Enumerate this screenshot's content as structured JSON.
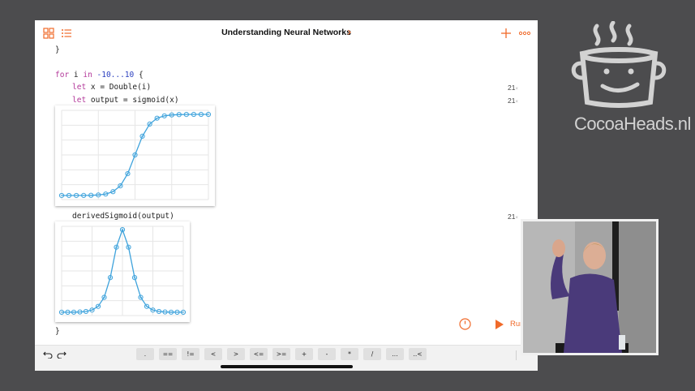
{
  "app": {
    "title": "Understanding Neural Networks",
    "accent_color": "#f06a2a",
    "top_left_icons": [
      "grid-icon",
      "list-icon"
    ],
    "top_right_icons": [
      "plus-icon",
      "more-icon"
    ]
  },
  "code": {
    "line_close_brace_1": "}",
    "line_for_kw1": "for",
    "line_for_var": " i ",
    "line_for_kw2": "in",
    "line_for_range": " -10...10",
    "line_for_open": " {",
    "line_let_x_kw": "let",
    "line_let_x_rest": " x = Double(i)",
    "line_let_output_kw": "let",
    "line_let_output_rest": " output = sigmoid(x)",
    "line_derived": "derivedSigmoid(output)",
    "line_close_brace_2": "}",
    "counts": [
      "21",
      "21",
      "21"
    ],
    "count_suffix": "×"
  },
  "run_button": {
    "label": "Run My Code"
  },
  "keyboard_keys": [
    ".",
    "==",
    "!=",
    "<",
    ">",
    "<=",
    ">=",
    "+",
    "-",
    "*",
    "/",
    "...",
    "..<"
  ],
  "keyboard_icons": [
    "undo-icon",
    "redo-icon"
  ],
  "branding": {
    "logo_text": "CocoaHeads.nl"
  },
  "chart_data": [
    {
      "type": "line",
      "name": "sigmoid",
      "x": [
        -10,
        -9,
        -8,
        -7,
        -6,
        -5,
        -4,
        -3,
        -2,
        -1,
        0,
        1,
        2,
        3,
        4,
        5,
        6,
        7,
        8,
        9,
        10
      ],
      "values": [
        4.54e-05,
        0.000123,
        0.000335,
        0.000911,
        0.00247,
        0.00669,
        0.018,
        0.0474,
        0.119,
        0.269,
        0.5,
        0.731,
        0.881,
        0.953,
        0.982,
        0.993,
        0.9975,
        0.9991,
        0.99966,
        0.99988,
        0.99995
      ],
      "ylim": [
        -0.05,
        1.05
      ],
      "grid": true,
      "line_color": "#3fa3dc"
    },
    {
      "type": "line",
      "name": "derivedSigmoid",
      "x": [
        -10,
        -9,
        -8,
        -7,
        -6,
        -5,
        -4,
        -3,
        -2,
        -1,
        0,
        1,
        2,
        3,
        4,
        5,
        6,
        7,
        8,
        9,
        10
      ],
      "values": [
        4.54e-05,
        0.000123,
        0.000335,
        0.00091,
        0.00247,
        0.00665,
        0.0177,
        0.0452,
        0.105,
        0.197,
        0.25,
        0.197,
        0.105,
        0.0452,
        0.0177,
        0.00665,
        0.00247,
        0.00091,
        0.000335,
        0.000123,
        4.54e-05
      ],
      "ylim": [
        -0.01,
        0.26
      ],
      "grid": true,
      "line_color": "#3fa3dc"
    }
  ]
}
